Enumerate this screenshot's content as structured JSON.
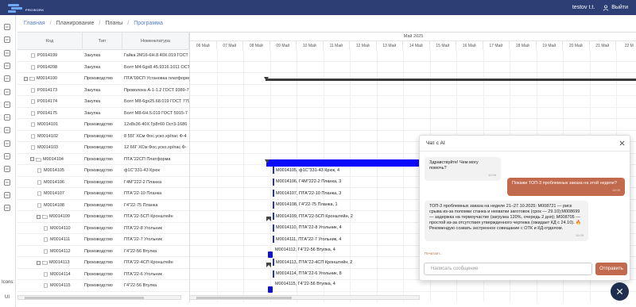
{
  "app": {
    "logo_text": "PROWORK",
    "user_name": "testov t.t.",
    "logout_label": "Выйти"
  },
  "sidebar": {
    "icons_label": "Icons:",
    "ui_label": "UI",
    "icons": [
      "home-icon",
      "calendar-icon",
      "list-icon",
      "file-icon",
      "factory-icon",
      "clipboard-icon",
      "globe-icon",
      "users-icon",
      "layers-icon",
      "box-icon",
      "tool-icon",
      "chart-icon",
      "database-icon",
      "grid-icon",
      "mic-icon"
    ]
  },
  "breadcrumb": {
    "items": [
      "Главная",
      "Планирование",
      "Планы",
      "Программа"
    ]
  },
  "table": {
    "headers": {
      "code": "Код",
      "type": "Тип",
      "nomenclature": "Номенклатура"
    },
    "rows": [
      {
        "code": "P0014199",
        "type": "Закупка",
        "nom": "Гайка 2М16-6Н.8.40Х.019 ГОСТ",
        "level": 2,
        "exp": ""
      },
      {
        "code": "P0014208",
        "type": "Закупка",
        "nom": "Болт М4-6gх8.45.9316.1011 ОСТ",
        "level": 2,
        "exp": ""
      },
      {
        "code": "M0014100",
        "type": "Производство",
        "nom": "ПТА\"09СП Установка платформ",
        "level": 1,
        "exp": "−"
      },
      {
        "code": "P0014173",
        "type": "Закупка",
        "nom": "Проволока А-1-1.2 ГОСТ 9389-7",
        "level": 2,
        "exp": ""
      },
      {
        "code": "P0014174",
        "type": "Закупка",
        "nom": "Болт М8-6gх25.68.019 ГОСТ 779",
        "level": 2,
        "exp": ""
      },
      {
        "code": "P0014175",
        "type": "Закупка",
        "nom": "Болт М8-6Н.5.019 ГОСТ 5915-7",
        "level": 2,
        "exp": ""
      },
      {
        "code": "M0014101",
        "type": "Производство",
        "nom": "12х8х36 40Х Гр8т60 Ост3-1686",
        "level": 2,
        "exp": ""
      },
      {
        "code": "M0014102",
        "type": "Производство",
        "nom": "8 55Г ХСм Фос.уско.хр/пас Ф-4",
        "level": 2,
        "exp": ""
      },
      {
        "code": "M0014103",
        "type": "Производство",
        "nom": "12 66Г ХСм Фос.уско.хр/пас Ф-",
        "level": 2,
        "exp": ""
      },
      {
        "code": "M0014104",
        "type": "Производство",
        "nom": "ПТА\"22СП Платформа",
        "level": 2,
        "exp": "−"
      },
      {
        "code": "M0014105",
        "type": "Производство",
        "nom": "ф1С\"331-43 Крюк",
        "level": 3,
        "exp": ""
      },
      {
        "code": "M0014106",
        "type": "Производство",
        "nom": "Г4М\"222-2 Планка",
        "level": 3,
        "exp": ""
      },
      {
        "code": "M0014107",
        "type": "Производство",
        "nom": "ПТА\"22-10 Планка",
        "level": 3,
        "exp": ""
      },
      {
        "code": "M0014108",
        "type": "Производство",
        "nom": "Г4\"22-75 Планка",
        "level": 3,
        "exp": ""
      },
      {
        "code": "M0014109",
        "type": "Производство",
        "nom": "ПТА\"22-5СП Кронштейн",
        "level": 3,
        "exp": "−"
      },
      {
        "code": "M0014110",
        "type": "Производство",
        "nom": "ПТА\"22-8 Угольник",
        "level": 4,
        "exp": ""
      },
      {
        "code": "M0014111",
        "type": "Производство",
        "nom": "ПТА\"22-7 Угольник",
        "level": 4,
        "exp": ""
      },
      {
        "code": "M0014112",
        "type": "Производство",
        "nom": "Г4\"22-56 Втулка",
        "level": 4,
        "exp": ""
      },
      {
        "code": "M0014113",
        "type": "Производство",
        "nom": "ПТА\"22-4СП Кронштейн",
        "level": 3,
        "exp": "−"
      },
      {
        "code": "M0014114",
        "type": "Производство",
        "nom": "ПТА\"22-6 Угольник",
        "level": 4,
        "exp": ""
      },
      {
        "code": "M0014115",
        "type": "Производство",
        "nom": "Г4\"22-56 Втулка",
        "level": 4,
        "exp": ""
      }
    ]
  },
  "gantt": {
    "month": "Май 2025",
    "days": [
      "06 Май",
      "07 Май",
      "08 Май",
      "09 Май",
      "10 Май",
      "11 Май",
      "12 Май",
      "13 Май",
      "14 Май",
      "15 Май",
      "16 Май",
      "17 Май",
      "18 Май",
      "19 Май",
      "20 Май",
      "21 Май",
      "22 М"
    ],
    "tasks": [
      {
        "row": 10,
        "text": "M0014105, ф1С\"331-43 Крюк, 4"
      },
      {
        "row": 11,
        "text": "M0014106, Г4М\"222-2 Планка, 3"
      },
      {
        "row": 12,
        "text": "M0014107, ПТА\"22-10 Планка, 3"
      },
      {
        "row": 13,
        "text": "M0014108, Г4\"22-75 Планка, 1"
      },
      {
        "row": 14,
        "text": "M0014109, ПТА\"22-5СП Кронштейн, 2"
      },
      {
        "row": 15,
        "text": "M0014110, ПТА\"22-8 Угольник, 4"
      },
      {
        "row": 16,
        "text": "M0014111, ПТА\"22-7 Угольник, 4"
      },
      {
        "row": 17,
        "text": "M0014112, Г4\"22-56 Втулка, 4"
      },
      {
        "row": 18,
        "text": "M0014113, ПТА\"22-4СП Кронштейн, 2"
      },
      {
        "row": 19,
        "text": "M0014114, ПТА\"22-6 Угольник, 8"
      },
      {
        "row": 20,
        "text": "M0014115, Г4\"22-56 Втулка, 4"
      }
    ]
  },
  "chat": {
    "title": "Чат с AI",
    "messages": [
      {
        "role": "bot",
        "text": "Здравствуйте! Чем могу помочь?",
        "time": "12:09"
      },
      {
        "role": "user",
        "text": "Покажи ТОП-3 проблемных заказа на этой неделе?",
        "time": "12:09"
      },
      {
        "role": "bot",
        "text": "ТОП-3 проблемных заказа на неделе 21–27.10.2025: M008721 — риск срыва из-за поломки станка и нехватки заготовок (срок — 29.10);M008699 — задержка на термоучастке (загрузка 120%, очередь 2 дня); M008705 — простой из-за отсутствия утвержденного чертежа (ожидает КД с 24.10). 🔥 Рекомендую созвать экстренное совещание с ОТК и КД-отделом.",
        "time": "12:09"
      }
    ],
    "typing": "Печатает...",
    "input_placeholder": "Написать сообщение",
    "send_label": "Отправить"
  }
}
